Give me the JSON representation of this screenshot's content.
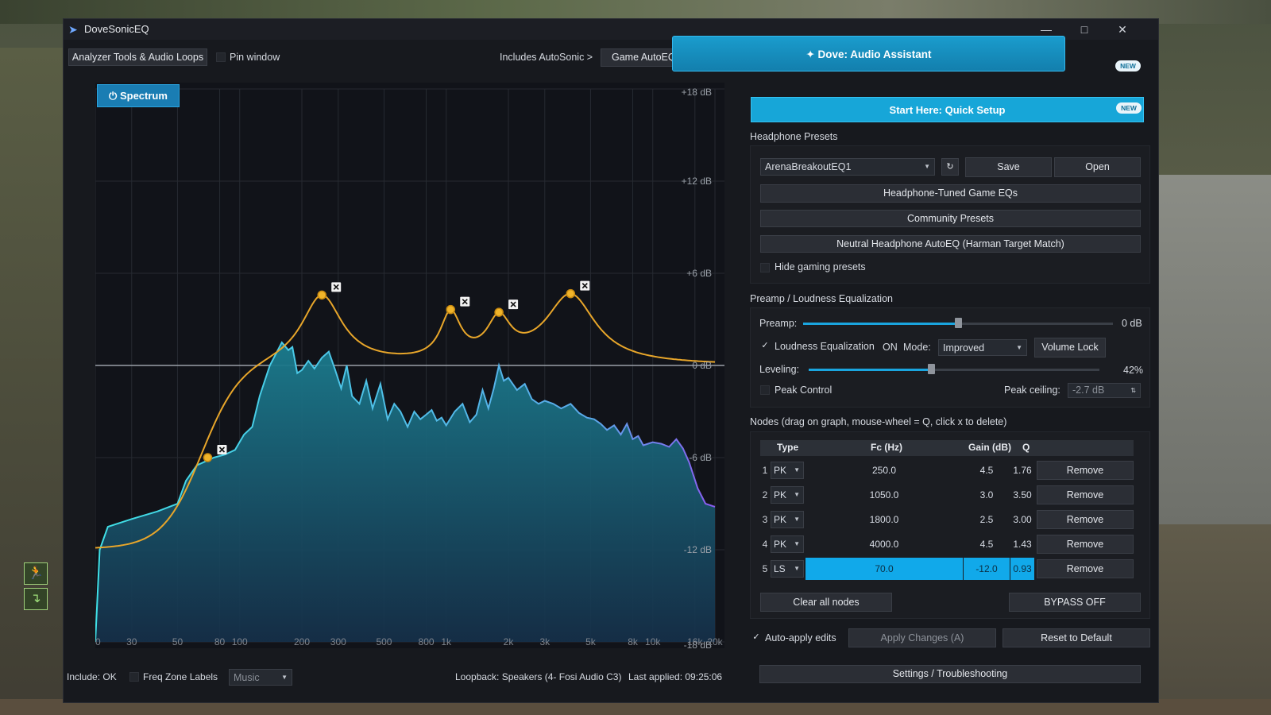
{
  "window": {
    "title": "DoveSonicEQ"
  },
  "toolbar": {
    "analyzer_tools": "Analyzer Tools & Audio Loops",
    "pin_window": "Pin window",
    "includes_autosonic": "Includes AutoSonic >",
    "game_autoeq_builder": "Game AutoEQ Builder"
  },
  "graph": {
    "spectrum_label": "Spectrum",
    "db_labels": [
      "+18 dB",
      "+12 dB",
      "+6 dB",
      "0 dB",
      "-6 dB",
      "-12 dB",
      "-18 dB"
    ],
    "freq_labels": [
      "20",
      "30",
      "50",
      "80",
      "100",
      "200",
      "300",
      "500",
      "800",
      "1k",
      "2k",
      "3k",
      "5k",
      "8k",
      "10k",
      "16k",
      "20k"
    ],
    "colors": {
      "eq_curve": "#e8a62a",
      "spectrum_top": "#3fe0e6",
      "spectrum_bottom": "#8b5bf0"
    }
  },
  "status": {
    "include": "Include: OK",
    "freq_zone_labels": "Freq Zone Labels",
    "zone_select": "Music",
    "loopback": "Loopback: Speakers (4- Fosi Audio C3)",
    "last_applied": "Last applied: 09:25:06"
  },
  "assistant": {
    "label": "Dove: Audio Assistant",
    "badge": "NEW"
  },
  "quick_setup": {
    "label": "Start Here: Quick Setup",
    "badge": "NEW"
  },
  "presets": {
    "header": "Headphone Presets",
    "selected": "ArenaBreakoutEQ1",
    "save": "Save",
    "open": "Open",
    "tuned": "Headphone-Tuned Game EQs",
    "community": "Community Presets",
    "neutral": "Neutral Headphone AutoEQ (Harman Target Match)",
    "hide_gaming": "Hide gaming presets"
  },
  "preamp": {
    "header": "Preamp / Loudness Equalization",
    "preamp_label": "Preamp:",
    "preamp_value": "0 dB",
    "preamp_fraction": 0.5,
    "loudness_label": "Loudness Equalization",
    "loudness_state": "ON",
    "mode_label": "Mode:",
    "mode_value": "Improved",
    "volume_lock": "Volume Lock",
    "leveling_label": "Leveling:",
    "leveling_value": "42%",
    "leveling_fraction": 0.42,
    "peak_control": "Peak Control",
    "peak_ceiling_label": "Peak ceiling:",
    "peak_ceiling_value": "-2.7 dB"
  },
  "nodes": {
    "header": "Nodes (drag on graph, mouse-wheel = Q, click x to delete)",
    "columns": [
      "Type",
      "Fc (Hz)",
      "Gain (dB)",
      "Q"
    ],
    "rows": [
      {
        "n": "1",
        "type": "PK",
        "fc": "250.0",
        "gain": "4.5",
        "q": "1.76",
        "remove": "Remove"
      },
      {
        "n": "2",
        "type": "PK",
        "fc": "1050.0",
        "gain": "3.0",
        "q": "3.50",
        "remove": "Remove"
      },
      {
        "n": "3",
        "type": "PK",
        "fc": "1800.0",
        "gain": "2.5",
        "q": "3.00",
        "remove": "Remove"
      },
      {
        "n": "4",
        "type": "PK",
        "fc": "4000.0",
        "gain": "4.5",
        "q": "1.43",
        "remove": "Remove"
      },
      {
        "n": "5",
        "type": "LS",
        "fc": "70.0",
        "gain": "-12.0",
        "q": "0.93",
        "remove": "Remove"
      }
    ],
    "clear_all": "Clear all nodes",
    "bypass": "BYPASS OFF"
  },
  "footer": {
    "auto_apply": "Auto-apply edits",
    "apply_changes": "Apply Changes (A)",
    "reset": "Reset to Default",
    "settings": "Settings / Troubleshooting"
  }
}
